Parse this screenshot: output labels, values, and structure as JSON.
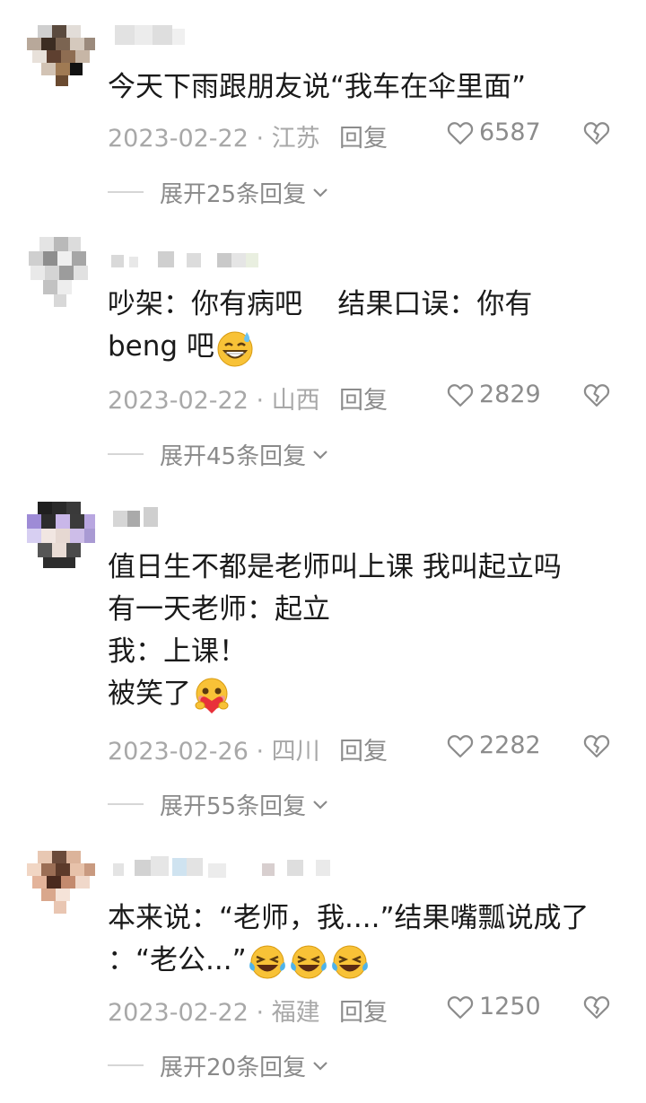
{
  "comments": [
    {
      "text_lines": [
        "今天下雨跟朋友说“我车在伞里面”"
      ],
      "date": "2023-02-22",
      "location": "江苏",
      "reply_label": "回复",
      "likes": "6587",
      "expand_label": "展开25条回复"
    },
    {
      "text_lines": [
        "吵架：你有病吧    结果口误：你有",
        "beng 吧"
      ],
      "date": "2023-02-22",
      "location": "山西",
      "reply_label": "回复",
      "likes": "2829",
      "expand_label": "展开45条回复"
    },
    {
      "text_lines": [
        "值日生不都是老师叫上课 我叫起立吗",
        "有一天老师：起立",
        "我：上课！",
        "被笑了"
      ],
      "date": "2023-02-26",
      "location": "四川",
      "reply_label": "回复",
      "likes": "2282",
      "expand_label": "展开55条回复"
    },
    {
      "text_lines": [
        "本来说：“老师，我....”结果嘴瓢说成了",
        "：“老公...”"
      ],
      "date": "2023-02-22",
      "location": "福建",
      "reply_label": "回复",
      "likes": "1250",
      "expand_label": "展开20条回复"
    }
  ],
  "meta_separator": " · ",
  "icons": {
    "like": "heart-outline-icon",
    "dislike": "broken-heart-icon",
    "expand": "chevron-down-icon"
  },
  "colors": {
    "text": "#1a1a1a",
    "meta": "#a8a8a8",
    "icon": "#8c8c8c"
  }
}
